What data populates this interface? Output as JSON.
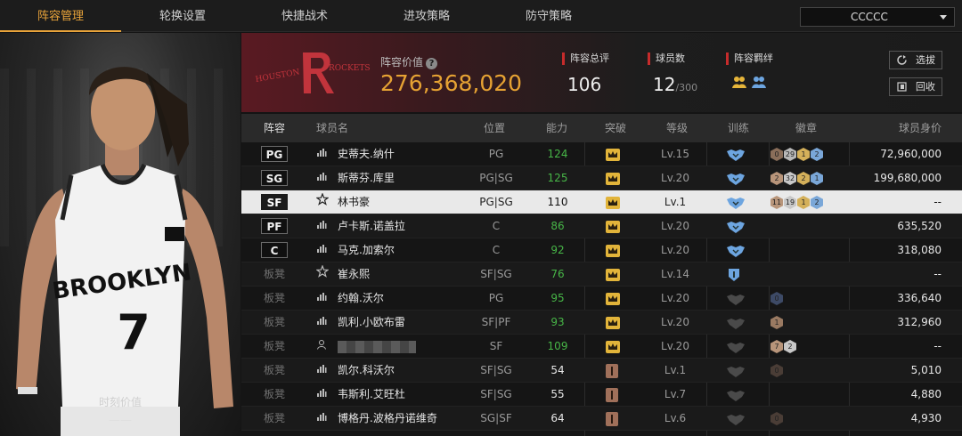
{
  "tabs": [
    {
      "label": "阵容管理",
      "active": true
    },
    {
      "label": "轮换设置",
      "active": false
    },
    {
      "label": "快捷战术",
      "active": false
    },
    {
      "label": "进攻策略",
      "active": false
    },
    {
      "label": "防守策略",
      "active": false
    }
  ],
  "team_select": {
    "value": "CCCCC"
  },
  "player_panel": {
    "jersey_team": "BROOKLYN",
    "jersey_number": "7",
    "value_label": "时刻价值",
    "value": "——"
  },
  "header": {
    "logo_text_left": "HOUSTON",
    "logo_text_right": "ROCKETS",
    "lineup_value_label": "阵容价值",
    "lineup_value": "276,368,020",
    "rating_label": "阵容总评",
    "rating": "106",
    "player_count_label": "球员数",
    "player_count": "12",
    "player_count_max": "/300",
    "bond_label": "阵容羁绊",
    "pick_button": "选拔",
    "recycle_button": "回收"
  },
  "table": {
    "headers": {
      "lineup": "阵容",
      "name": "球员名",
      "position": "位置",
      "ability": "能力",
      "breakthrough": "突破",
      "level": "等级",
      "training": "训练",
      "badges": "徽章",
      "value": "球员身价"
    },
    "rows": [
      {
        "slot": "PG",
        "bench": false,
        "icon": "stats-icon",
        "name": "史蒂夫.纳什",
        "role": "PG",
        "ability": "124",
        "ability_color": "green",
        "bk": "crown",
        "level": "Lv.15",
        "train": "blue",
        "badges": [
          [
            "0",
            "#8a6e5a"
          ],
          [
            "29",
            "#b8b8b8"
          ],
          [
            "1",
            "#d4b05a"
          ],
          [
            "2",
            "#7aa7d8"
          ]
        ],
        "value": "72,960,000",
        "sel": false
      },
      {
        "slot": "SG",
        "bench": false,
        "icon": "stats-icon",
        "name": "斯蒂芬.库里",
        "role": "PG|SG",
        "ability": "125",
        "ability_color": "green",
        "bk": "crown",
        "level": "Lv.20",
        "train": "blue",
        "badges": [
          [
            "2",
            "#b8957a"
          ],
          [
            "32",
            "#c8c8c8"
          ],
          [
            "2",
            "#d4b05a"
          ],
          [
            "1",
            "#7aa7d8"
          ]
        ],
        "value": "199,680,000",
        "sel": false
      },
      {
        "slot": "SF",
        "bench": false,
        "icon": "star-icon",
        "name": "林书豪",
        "role": "PG|SG",
        "ability": "110",
        "ability_color": "white",
        "bk": "crown",
        "level": "Lv.1",
        "train": "blue",
        "badges": [
          [
            "11",
            "#b8957a"
          ],
          [
            "19",
            "#c8c8c8"
          ],
          [
            "1",
            "#d4b05a"
          ],
          [
            "2",
            "#7aa7d8"
          ]
        ],
        "value": "--",
        "sel": true
      },
      {
        "slot": "PF",
        "bench": false,
        "icon": "stats-icon",
        "name": "卢卡斯.诺盖拉",
        "role": "C",
        "ability": "86",
        "ability_color": "green",
        "bk": "crown",
        "level": "Lv.20",
        "train": "blue",
        "badges": [],
        "value": "635,520",
        "sel": false
      },
      {
        "slot": "C",
        "bench": false,
        "icon": "stats-icon",
        "name": "马克.加索尔",
        "role": "C",
        "ability": "92",
        "ability_color": "green",
        "bk": "crown",
        "level": "Lv.20",
        "train": "blue",
        "badges": [],
        "value": "318,080",
        "sel": false
      },
      {
        "slot": "板凳",
        "bench": true,
        "icon": "star-icon",
        "name": "崔永熙",
        "role": "SF|SG",
        "ability": "76",
        "ability_color": "green",
        "bk": "crown",
        "level": "Lv.14",
        "train": "blue1",
        "badges": [],
        "value": "--",
        "sel": false
      },
      {
        "slot": "板凳",
        "bench": true,
        "icon": "stats-icon",
        "name": "约翰.沃尔",
        "role": "PG",
        "ability": "95",
        "ability_color": "green",
        "bk": "crown",
        "level": "Lv.20",
        "train": "gray",
        "badges": [
          [
            "0",
            "#3d4a66"
          ]
        ],
        "value": "336,640",
        "sel": false
      },
      {
        "slot": "板凳",
        "bench": true,
        "icon": "stats-icon",
        "name": "凯利.小欧布雷",
        "role": "SF|PF",
        "ability": "93",
        "ability_color": "green",
        "bk": "crown",
        "level": "Lv.20",
        "train": "gray",
        "badges": [
          [
            "1",
            "#9a7a62"
          ]
        ],
        "value": "312,960",
        "sel": false
      },
      {
        "slot": "板凳",
        "bench": true,
        "icon": "person-icon",
        "name": "",
        "censored": true,
        "role": "SF",
        "ability": "109",
        "ability_color": "green",
        "bk": "crown",
        "level": "Lv.20",
        "train": "gray",
        "badges": [
          [
            "7",
            "#b8957a"
          ],
          [
            "2",
            "#c8c8c8"
          ]
        ],
        "value": "--",
        "sel": false
      },
      {
        "slot": "板凳",
        "bench": true,
        "icon": "stats-icon",
        "name": "凯尔.科沃尔",
        "role": "SF|SG",
        "ability": "54",
        "ability_color": "white",
        "bk": "one",
        "level": "Lv.1",
        "train": "gray",
        "badges": [
          [
            "0",
            "#4a3d36"
          ]
        ],
        "value": "5,010",
        "sel": false
      },
      {
        "slot": "板凳",
        "bench": true,
        "icon": "stats-icon",
        "name": "韦斯利.艾旺杜",
        "role": "SF|SG",
        "ability": "55",
        "ability_color": "white",
        "bk": "one",
        "level": "Lv.7",
        "train": "gray",
        "badges": [],
        "value": "4,880",
        "sel": false
      },
      {
        "slot": "板凳",
        "bench": true,
        "icon": "stats-icon",
        "name": "博格丹.波格丹诺维奇",
        "role": "SG|SF",
        "ability": "64",
        "ability_color": "white",
        "bk": "one",
        "level": "Lv.6",
        "train": "gray",
        "badges": [
          [
            "0",
            "#4a3d36"
          ]
        ],
        "value": "4,930",
        "sel": false
      }
    ]
  }
}
